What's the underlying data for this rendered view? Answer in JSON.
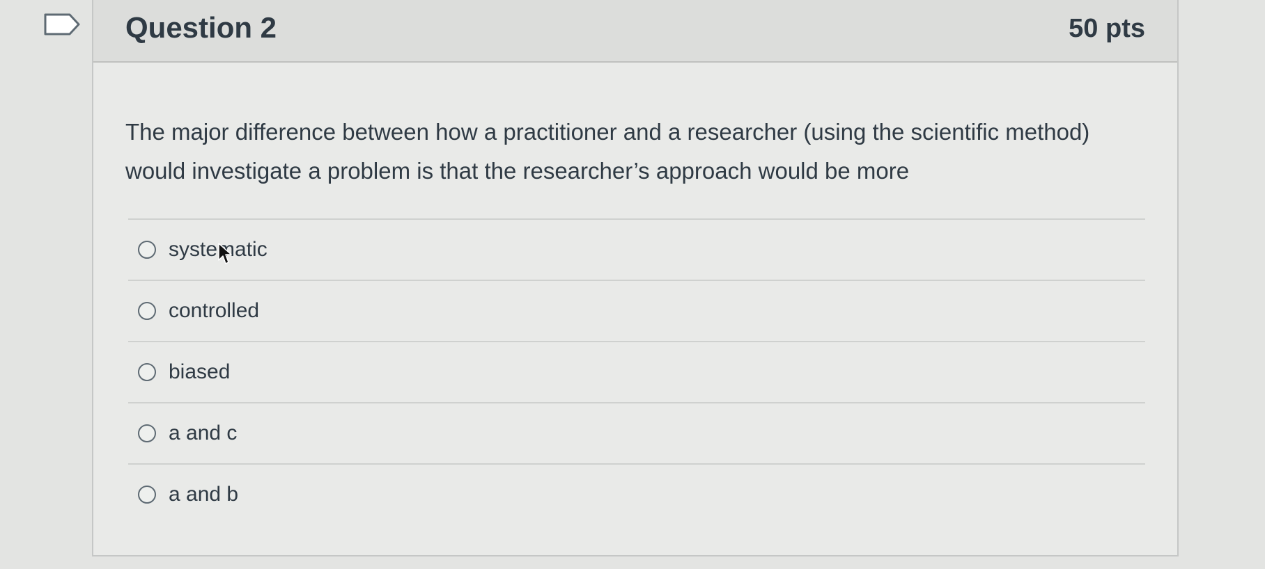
{
  "question": {
    "title": "Question 2",
    "points": "50 pts",
    "text": "The major difference between how a practitioner and a researcher (using the scientific method) would investigate a problem is that the researcher’s approach would be more"
  },
  "answers": [
    {
      "label": "systematic"
    },
    {
      "label": "controlled"
    },
    {
      "label": "biased"
    },
    {
      "label": "a and c"
    },
    {
      "label": "a and b"
    }
  ],
  "icons": {
    "flag": "flag-question-icon",
    "cursor": "mouse-pointer-icon"
  },
  "colors": {
    "background": "#e3e4e2",
    "header": "#dcdddb",
    "text": "#2f3a44"
  }
}
